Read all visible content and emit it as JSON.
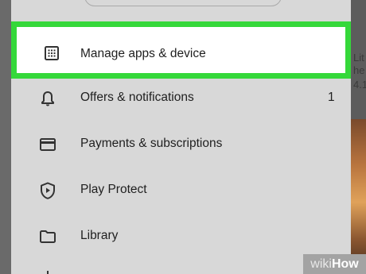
{
  "background_app": {
    "lines": [
      "Lit",
      "he",
      "4.1"
    ]
  },
  "drawer": {
    "menu_items": [
      {
        "name": "menu-item-manage-apps",
        "label": "Manage apps & device",
        "icon": "grid-icon",
        "highlighted": true
      },
      {
        "name": "menu-item-offers",
        "label": "Offers & notifications",
        "icon": "bell-icon",
        "badge": "1"
      },
      {
        "name": "menu-item-payments",
        "label": "Payments & subscriptions",
        "icon": "credit-card-icon"
      },
      {
        "name": "menu-item-play-protect",
        "label": "Play Protect",
        "icon": "shield-play-icon"
      },
      {
        "name": "menu-item-library",
        "label": "Library",
        "icon": "folder-icon"
      }
    ]
  },
  "watermark": {
    "wiki": "wiki",
    "how": "How"
  },
  "colors": {
    "highlight_border": "#35d83a",
    "drawer_bg": "#d8d8d8",
    "icon": "#333333"
  }
}
